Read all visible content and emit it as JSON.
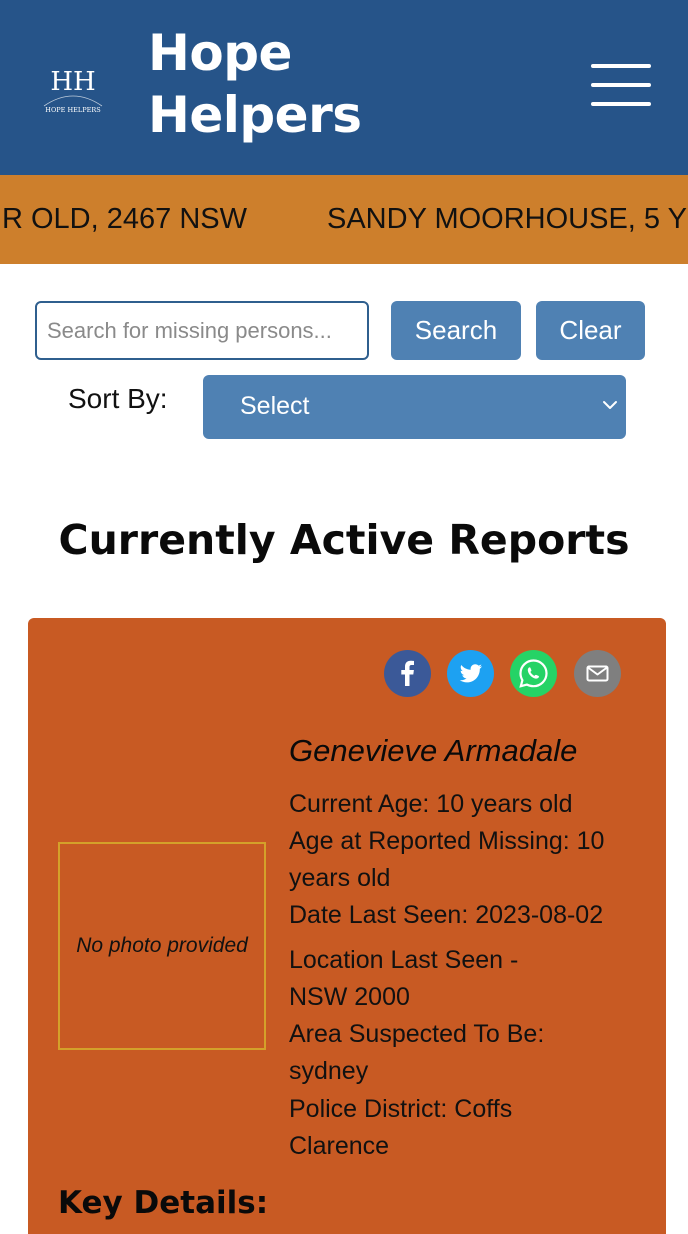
{
  "header": {
    "logo_text": "HH",
    "logo_caption": "HOPE HELPERS",
    "brand_line1": "Hope",
    "brand_line2": "Helpers",
    "menu_icon": "hamburger-menu-icon"
  },
  "ticker": {
    "items": [
      "R OLD, 2467 NSW",
      "SANDY MOORHOUSE, 5 Y"
    ]
  },
  "search": {
    "placeholder": "Search for missing persons...",
    "value": "",
    "search_label": "Search",
    "clear_label": "Clear"
  },
  "sort": {
    "label": "Sort By:",
    "selected": "Select"
  },
  "section_title": "Currently Active Reports",
  "report": {
    "share_icons": [
      "facebook-icon",
      "twitter-icon",
      "whatsapp-icon",
      "email-icon"
    ],
    "photo_placeholder": "No photo provided",
    "name": "Genevieve Armadale",
    "current_age": "Current Age: 10 years old",
    "age_missing_1": "Age at Reported Missing: 10",
    "age_missing_2": "years old",
    "date_last_seen": "Date Last Seen: 2023-08-02",
    "location_1": "Location Last Seen -",
    "location_2": "NSW 2000",
    "area_1": "Area Suspected To Be:",
    "area_2": "sydney",
    "district_1": "Police District: Coffs",
    "district_2": "Clarence",
    "key_details_heading": "Key Details:"
  },
  "colors": {
    "header_bg": "#265489",
    "ticker_bg": "#cd7f2c",
    "button_bg": "#4f81b3",
    "card_bg": "#c85a23",
    "photo_border": "#d4a12a"
  }
}
